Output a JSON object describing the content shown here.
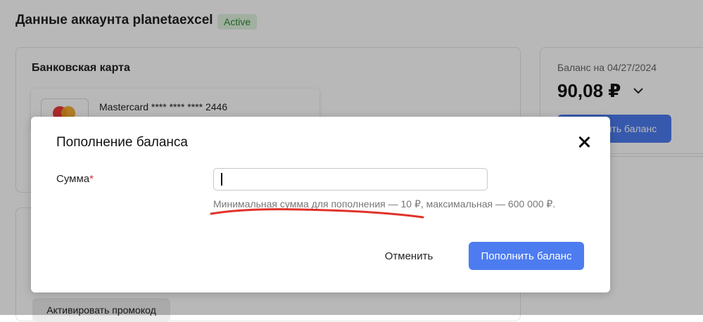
{
  "page": {
    "title": "Данные аккаунта planetaexcel",
    "status_badge": "Active"
  },
  "bank_card": {
    "section_title": "Банковская карта",
    "card_label": "Mastercard **** **** **** 2446"
  },
  "promo": {
    "button_label": "Активировать промокод"
  },
  "balance": {
    "label": "Баланс на 04/27/2024",
    "value": "90,08 ₽",
    "topup_label": "Пополнить баланс"
  },
  "modal": {
    "title": "Пополнение баланса",
    "amount_label": "Сумма",
    "required_mark": "*",
    "amount_value": "",
    "hint": "Минимальная сумма для пополнения — 10 ₽, максимальная — 600 000 ₽.",
    "cancel_label": "Отменить",
    "submit_label": "Пополнить баланс"
  },
  "colors": {
    "accent": "#4d7cf0",
    "badge_bg": "#dff3df",
    "badge_text": "#2f8a2f",
    "required": "#d93333",
    "annotation": "#e0322a"
  },
  "icons": {
    "close": "close-icon",
    "chevron": "chevron-down-icon",
    "card_brand": "mastercard-logo-icon"
  }
}
